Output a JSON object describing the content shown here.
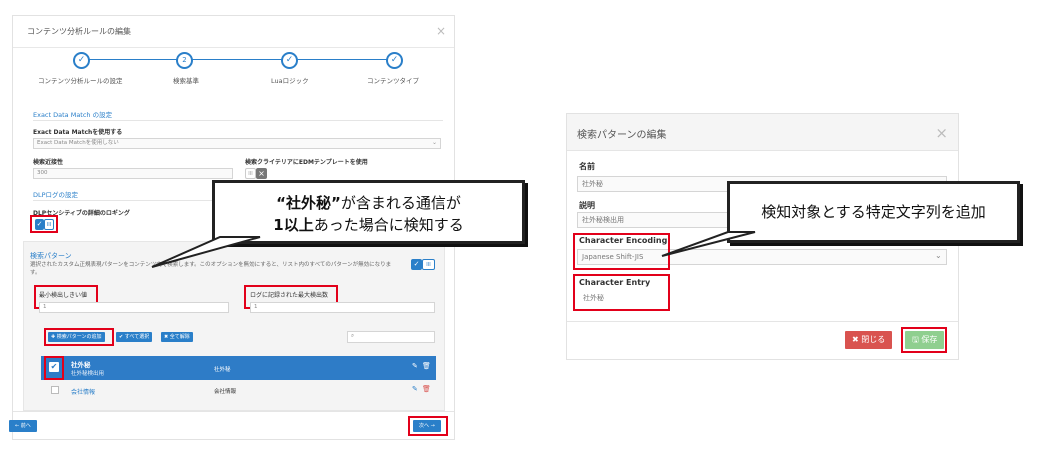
{
  "left": {
    "title": "コンテンツ分析ルールの編集",
    "steps": [
      {
        "label": "コンテンツ分析ルールの設定",
        "state": "done",
        "mark": "✓"
      },
      {
        "label": "検索基準",
        "state": "current",
        "mark": "2"
      },
      {
        "label": "Luaロジック",
        "state": "done",
        "mark": "✓"
      },
      {
        "label": "コンテンツタイプ",
        "state": "done",
        "mark": "✓"
      }
    ],
    "edm": {
      "section": "Exact Data Match の設定",
      "use_label": "Exact Data Matchを使用する",
      "use_value": "Exact Data Matchを使用しない",
      "proximity_label": "検索近接性",
      "proximity_value": "300",
      "edm_template_label": "検索クライテリアにEDMテンプレートを使用",
      "edm_toggle": "III"
    },
    "dlp": {
      "section": "DLPログの設定",
      "detail_label": "DLPセンシティブの詳細のロギング",
      "toggle": "III"
    },
    "patterns": {
      "title": "検索パターン",
      "desc": "選択されたカスタム正規表現パターンをコンテンツ内で検索します。このオプションを無効にすると、リスト内のすべてのパターンが無効になります。",
      "toggle": "III",
      "min_label": "最小検出しきい値",
      "min_value": "1",
      "max_label": "ログに記録された最大検出数",
      "max_value": "1",
      "add_btn": "検索パターンの追加",
      "select_all": "すべて選択",
      "clear_all": "全て解除",
      "rows": [
        {
          "name": "社外秘",
          "sub": "社外秘検出用",
          "value": "社外秘",
          "checked": true
        },
        {
          "name": "会社情報",
          "sub": "",
          "value": "会社情報",
          "checked": false
        }
      ]
    },
    "back_btn": "前へ",
    "next_btn": "次へ"
  },
  "callout_left": {
    "line1_a": "“社外秘”",
    "line1_b": "が含まれる通信が",
    "line2_a": "1以上",
    "line2_b": "あった場合に検知する"
  },
  "right": {
    "title": "検索パターンの編集",
    "name_label": "名前",
    "name_value": "社外秘",
    "desc_label": "説明",
    "desc_value": "社外秘検出用",
    "enc_label": "Character Encoding",
    "enc_value": "Japanese Shift-JIS",
    "entry_label": "Character Entry",
    "entry_value": "社外秘",
    "close_btn": "閉じる",
    "save_btn": "保存"
  },
  "callout_right": {
    "text": "検知対象とする特定文字列を追加"
  },
  "colors": {
    "accent": "#2a7fc9",
    "row_selected": "#2e7cc7",
    "danger": "#d9534f",
    "success": "#8fcf8f",
    "highlight": "#e2001a"
  }
}
